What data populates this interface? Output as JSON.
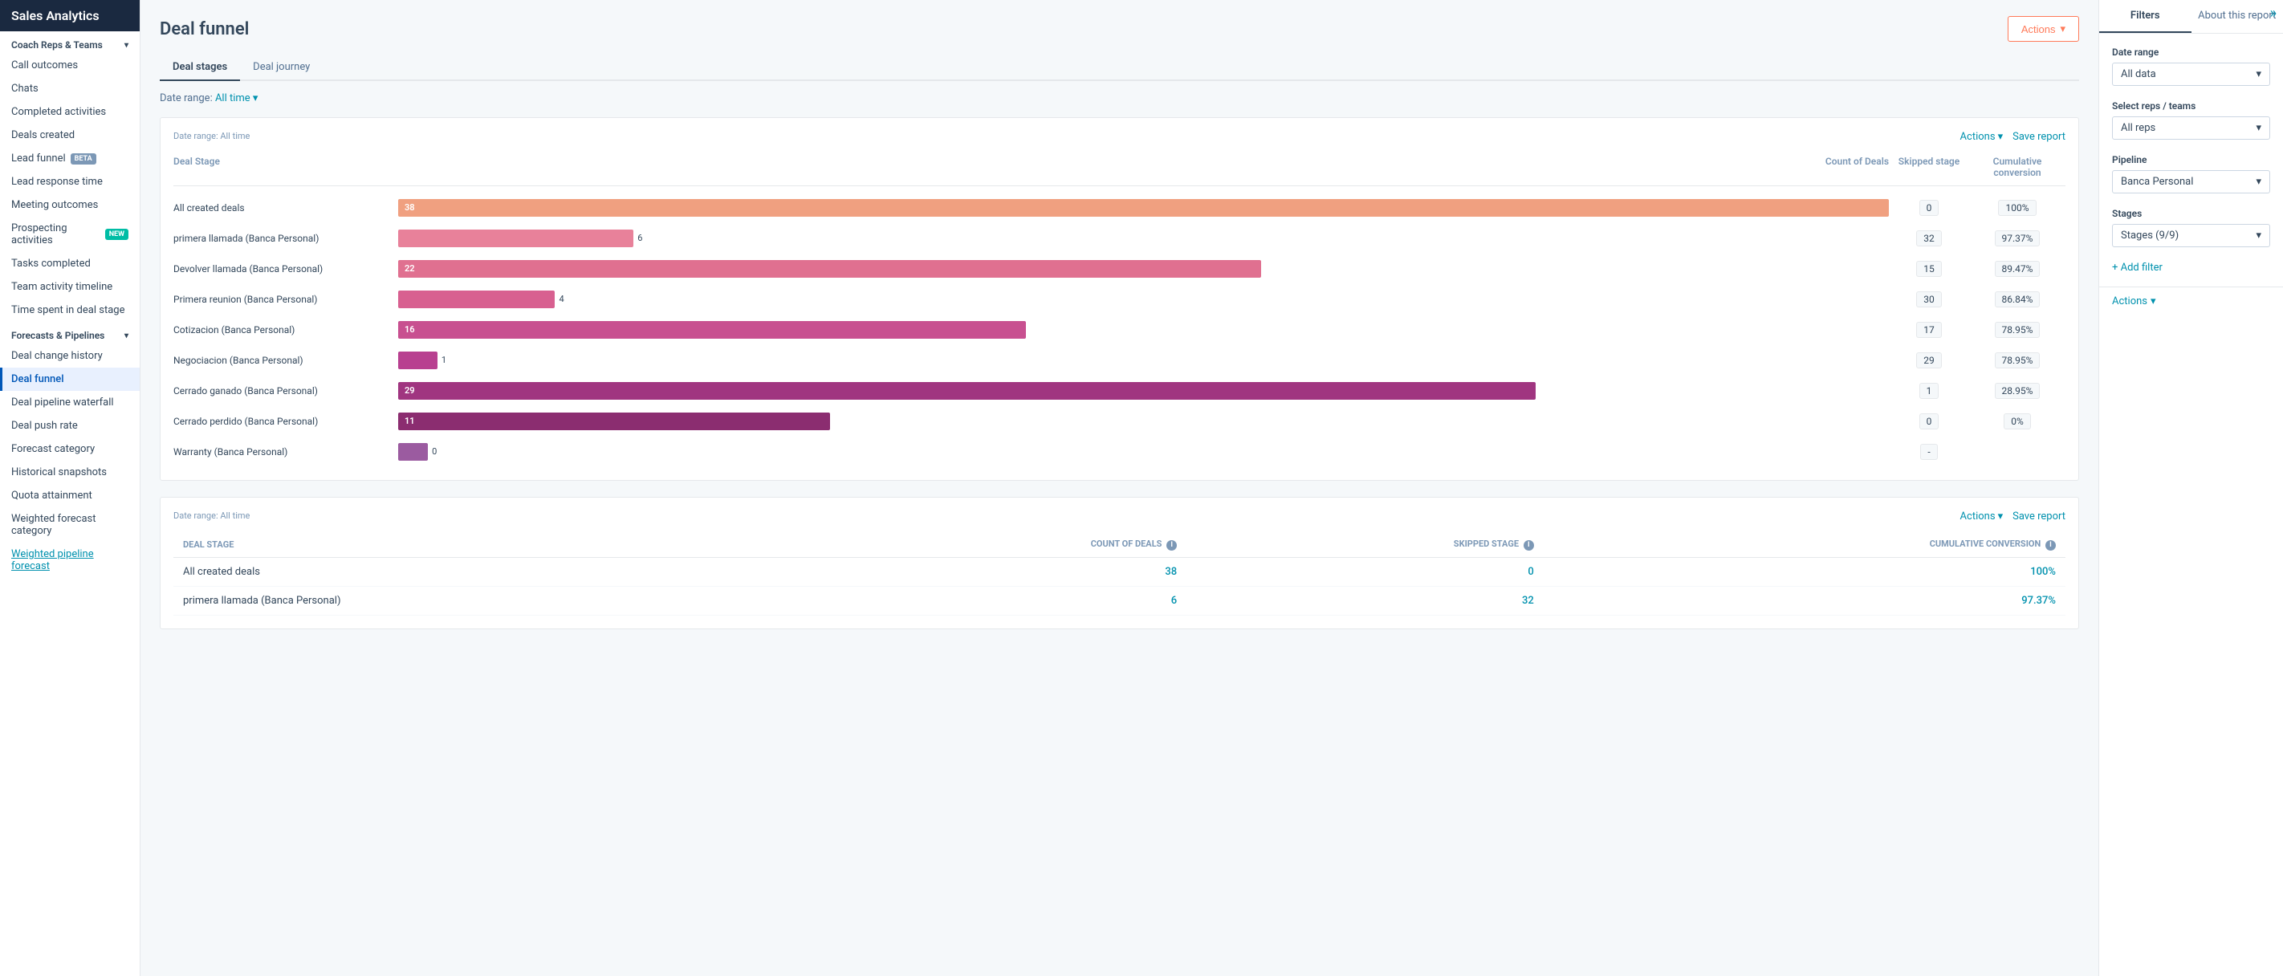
{
  "app": {
    "title": "Sales Analytics"
  },
  "sidebar": {
    "sections": [
      {
        "label": "Coach Reps & Teams",
        "items": [
          {
            "id": "call-outcomes",
            "label": "Call outcomes",
            "active": false,
            "badge": null
          },
          {
            "id": "chats",
            "label": "Chats",
            "active": false,
            "badge": null
          },
          {
            "id": "completed-activities",
            "label": "Completed activities",
            "active": false,
            "badge": null
          },
          {
            "id": "deals-created",
            "label": "Deals created",
            "active": false,
            "badge": null
          },
          {
            "id": "lead-funnel",
            "label": "Lead funnel",
            "active": false,
            "badge": "BETA"
          },
          {
            "id": "lead-response-time",
            "label": "Lead response time",
            "active": false,
            "badge": null
          },
          {
            "id": "meeting-outcomes",
            "label": "Meeting outcomes",
            "active": false,
            "badge": null
          },
          {
            "id": "prospecting-activities",
            "label": "Prospecting activities",
            "active": false,
            "badge": "NEW"
          },
          {
            "id": "tasks-completed",
            "label": "Tasks completed",
            "active": false,
            "badge": null
          },
          {
            "id": "team-activity-timeline",
            "label": "Team activity timeline",
            "active": false,
            "badge": null
          },
          {
            "id": "time-spent",
            "label": "Time spent in deal stage",
            "active": false,
            "badge": null
          }
        ]
      },
      {
        "label": "Forecasts & Pipelines",
        "items": [
          {
            "id": "deal-change-history",
            "label": "Deal change history",
            "active": false,
            "badge": null
          },
          {
            "id": "deal-funnel",
            "label": "Deal funnel",
            "active": true,
            "badge": null
          },
          {
            "id": "deal-pipeline-waterfall",
            "label": "Deal pipeline waterfall",
            "active": false,
            "badge": null
          },
          {
            "id": "deal-push-rate",
            "label": "Deal push rate",
            "active": false,
            "badge": null
          },
          {
            "id": "forecast-category",
            "label": "Forecast category",
            "active": false,
            "badge": null
          },
          {
            "id": "historical-snapshots",
            "label": "Historical snapshots",
            "active": false,
            "badge": null
          },
          {
            "id": "quota-attainment",
            "label": "Quota attainment",
            "active": false,
            "badge": null
          },
          {
            "id": "weighted-forecast-category",
            "label": "Weighted forecast category",
            "active": false,
            "badge": null
          },
          {
            "id": "weighted-pipeline-forecast",
            "label": "Weighted pipeline forecast",
            "active": false,
            "badge": null
          }
        ]
      }
    ]
  },
  "page": {
    "title": "Deal funnel",
    "actions_label": "Actions",
    "tabs": [
      {
        "id": "deal-stages",
        "label": "Deal stages",
        "active": true
      },
      {
        "id": "deal-journey",
        "label": "Deal journey",
        "active": false
      }
    ],
    "date_range_label": "Date range:",
    "date_range_value": "All time"
  },
  "chart": {
    "date_range": "Date range: All time",
    "col_deal_stage": "Deal Stage",
    "col_count": "Count of Deals",
    "col_skipped": "Skipped stage",
    "col_conversion": "Cumulative conversion",
    "actions_label": "Actions",
    "save_label": "Save report",
    "rows": [
      {
        "label": "All created deals",
        "value": 38,
        "bar_pct": 100,
        "skipped": "0",
        "conversion": "100%",
        "color": "#f0a080"
      },
      {
        "label": "primera llamada (Banca Personal)",
        "value": 6,
        "bar_pct": 90,
        "skipped": "32",
        "conversion": "97.37%",
        "color": "#e8819a"
      },
      {
        "label": "Devolver llamada (Banca Personal)",
        "value": 22,
        "bar_pct": 78,
        "skipped": "15",
        "conversion": "89.47%",
        "color": "#e07090"
      },
      {
        "label": "Primera reunion (Banca Personal)",
        "value": 4,
        "bar_pct": 72,
        "skipped": "30",
        "conversion": "86.84%",
        "color": "#d86090"
      },
      {
        "label": "Cotizacion (Banca Personal)",
        "value": 16,
        "bar_pct": 65,
        "skipped": "17",
        "conversion": "78.95%",
        "color": "#c85090"
      },
      {
        "label": "Negociacion (Banca Personal)",
        "value": 1,
        "bar_pct": 65,
        "skipped": "29",
        "conversion": "78.95%",
        "color": "#b84090"
      },
      {
        "label": "Cerrado ganado (Banca Personal)",
        "value": 29,
        "bar_pct": 55,
        "skipped": "1",
        "conversion": "28.95%",
        "color": "#a03580"
      },
      {
        "label": "Cerrado perdido (Banca Personal)",
        "value": 11,
        "bar_pct": 58,
        "skipped": "0",
        "conversion": "0%",
        "color": "#8b2d70"
      },
      {
        "label": "Warranty (Banca Personal)",
        "value": 0,
        "bar_pct": 5,
        "skipped": "-",
        "conversion": "",
        "color": "#9b5ba0"
      }
    ]
  },
  "table": {
    "date_range": "Date range: All time",
    "actions_label": "Actions",
    "save_label": "Save report",
    "col_deal_stage": "DEAL STAGE",
    "col_count": "COUNT OF DEALS",
    "col_skipped": "SKIPPED STAGE",
    "col_conversion": "CUMULATIVE CONVERSION",
    "rows": [
      {
        "label": "All created deals",
        "count": "38",
        "skipped": "0",
        "conversion": "100%"
      },
      {
        "label": "primera llamada (Banca Personal)",
        "count": "6",
        "skipped": "32",
        "conversion": "97.37%"
      }
    ]
  },
  "right_panel": {
    "tabs": [
      {
        "id": "filters",
        "label": "Filters",
        "active": true
      },
      {
        "id": "about",
        "label": "About this report",
        "active": false
      }
    ],
    "date_range_label": "Date range",
    "date_range_value": "All data",
    "reps_label": "Select reps / teams",
    "reps_value": "All reps",
    "pipeline_label": "Pipeline",
    "pipeline_value": "Banca Personal",
    "stages_label": "Stages",
    "stages_value": "Stages (9/9)",
    "add_filter_label": "+ Add filter",
    "actions_label": "Actions"
  }
}
